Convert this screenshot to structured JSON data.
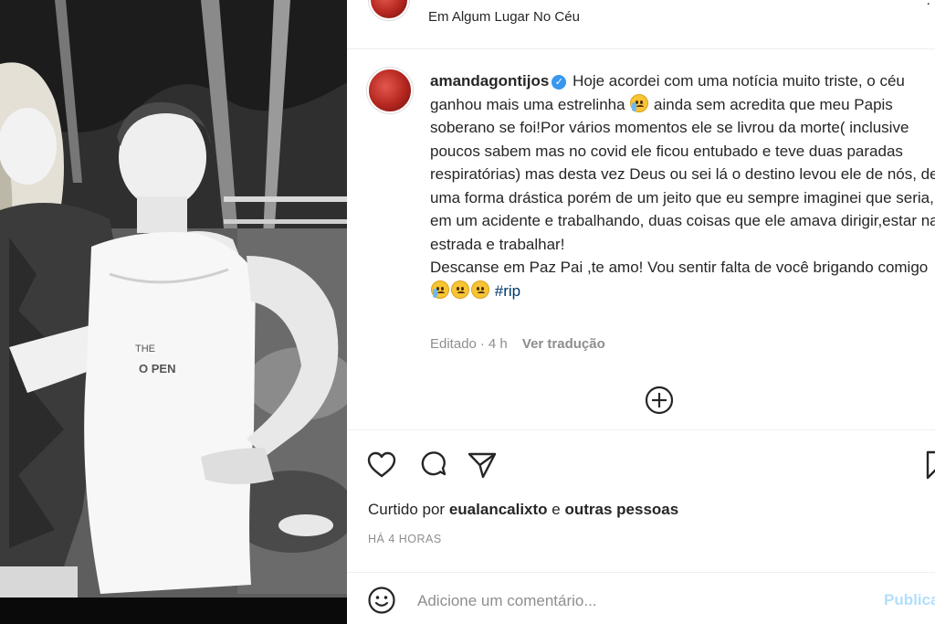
{
  "photo": {
    "description_icon": "photo-of-woman-and-man"
  },
  "header": {
    "location": "Em Algum Lugar No Céu",
    "more_icon": "ellipsis-icon"
  },
  "caption": {
    "username": "amandagontijos",
    "verified_icon": "verified-badge-icon",
    "text_part1": "Hoje acordei com uma notícia muito triste, o céu ganhou mais uma estrelinha",
    "text_part2": "ainda sem acredita que meu Papis soberano se foi!Por vários momentos ele se livrou da morte( inclusive poucos sabem mas no covid ele ficou entubado e teve duas paradas respiratórias) mas desta vez Deus ou sei lá o destino levou ele de nós, de uma forma drástica porém de um jeito que eu sempre imaginei que seria, em um acidente e trabalhando, duas coisas que ele amava dirigir,estar na estrada e trabalhar!",
    "text_part3": "Descanse em Paz Pai ,te amo! Vou sentir falta de você brigando comigo",
    "hashtag": "#rip"
  },
  "meta": {
    "edited": "Editado",
    "separator": "·",
    "age": "4 h",
    "translate": "Ver tradução"
  },
  "likes": {
    "prefix": "Curtido por",
    "user": "eualancalixto",
    "conj": "e",
    "others": "outras pessoas"
  },
  "timestamp": "HÁ 4 HORAS",
  "comment": {
    "placeholder": "Adicione um comentário...",
    "publish": "Publicar"
  },
  "colors": {
    "link": "#00376b",
    "verified": "#3897f0",
    "publish_disabled": "#b2dffc",
    "muted": "#8e8e8e"
  }
}
